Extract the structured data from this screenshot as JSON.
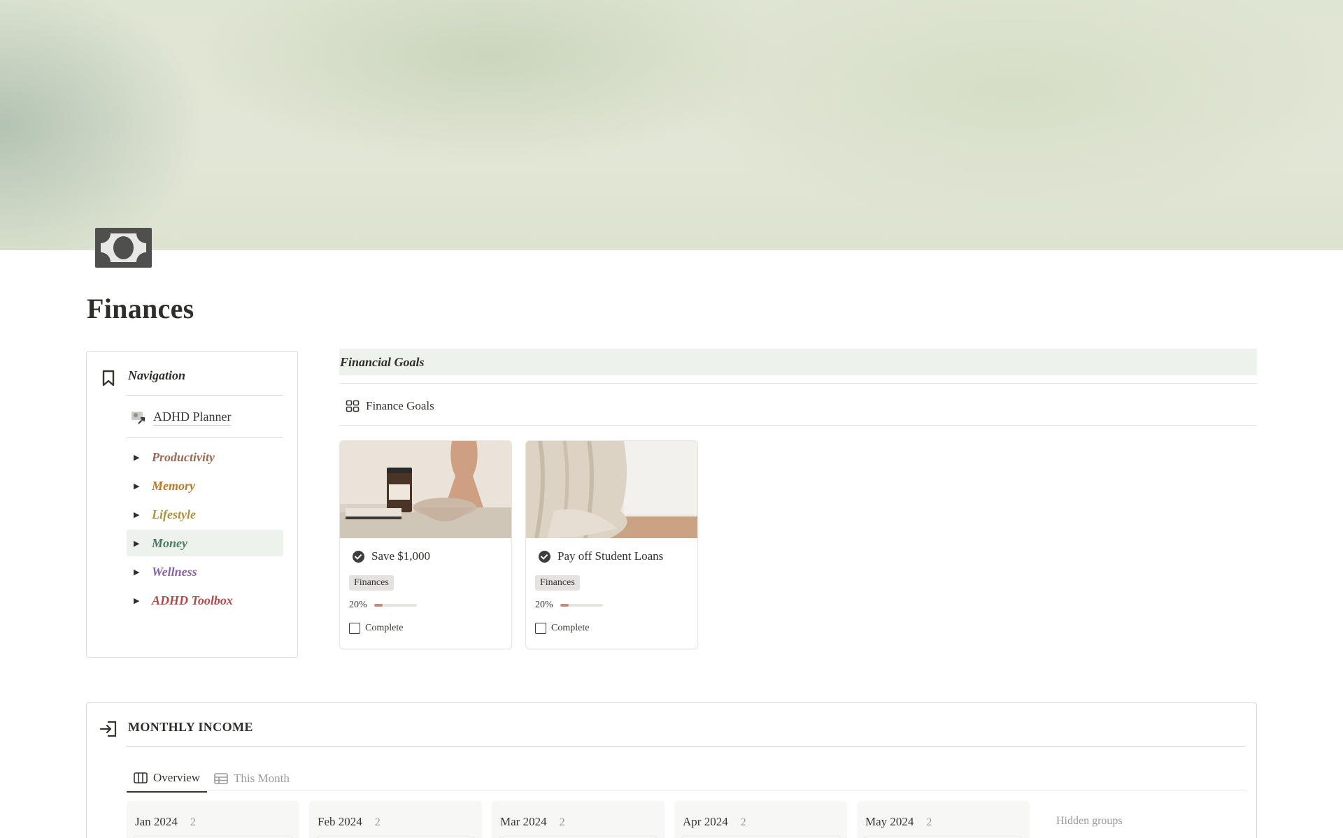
{
  "page": {
    "title": "Finances",
    "icon": "money-bill-icon"
  },
  "navigation": {
    "title": "Navigation",
    "link": {
      "label": "ADHD Planner",
      "icon": "page-link-icon"
    },
    "items": [
      {
        "label": "Productivity",
        "color": "#9a6a55"
      },
      {
        "label": "Memory",
        "color": "#b87a2a"
      },
      {
        "label": "Lifestyle",
        "color": "#b0923a"
      },
      {
        "label": "Money",
        "color": "#4c7a5e",
        "active": true
      },
      {
        "label": "Wellness",
        "color": "#8a63a6"
      },
      {
        "label": "ADHD Toolbox",
        "color": "#b04a4a"
      }
    ]
  },
  "goals": {
    "heading": "Financial Goals",
    "view_label": "Finance Goals",
    "cards": [
      {
        "title": "Save $1,000",
        "tag": "Finances",
        "progress_text": "20%",
        "progress": 0.2,
        "complete_label": "Complete"
      },
      {
        "title": "Pay off Student Loans",
        "tag": "Finances",
        "progress_text": "20%",
        "progress": 0.2,
        "complete_label": "Complete"
      }
    ]
  },
  "income": {
    "title": "MONTHLY INCOME",
    "tabs": [
      {
        "label": "Overview",
        "active": true
      },
      {
        "label": "This Month",
        "active": false
      }
    ],
    "groups": [
      {
        "name": "Jan 2024",
        "count": "2"
      },
      {
        "name": "Feb 2024",
        "count": "2"
      },
      {
        "name": "Mar 2024",
        "count": "2"
      },
      {
        "name": "Apr 2024",
        "count": "2"
      },
      {
        "name": "May 2024",
        "count": "2"
      }
    ],
    "hidden_groups_label": "Hidden groups"
  }
}
